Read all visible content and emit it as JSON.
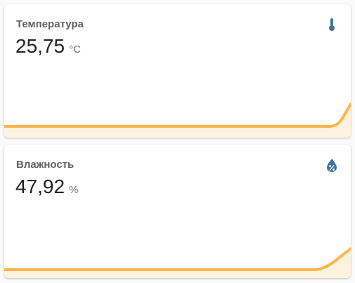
{
  "cards": [
    {
      "title": "Температура",
      "value": "25,75",
      "unit": "°C",
      "icon": "thermometer-icon",
      "accent_color": "#ffb74d",
      "icon_color": "#44739e"
    },
    {
      "title": "Влажность",
      "value": "47,92",
      "unit": "%",
      "icon": "water-percent-icon",
      "accent_color": "#ffb74d",
      "icon_color": "#44739e"
    }
  ]
}
